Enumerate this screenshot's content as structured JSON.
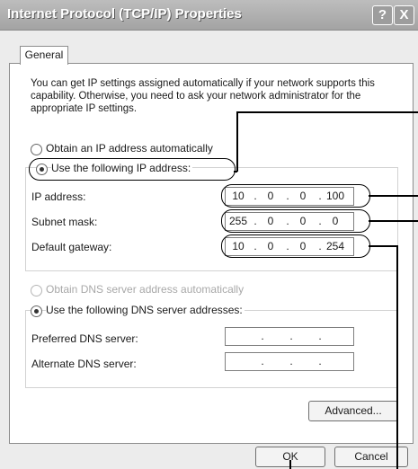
{
  "window": {
    "title": "Internet Protocol (TCP/IP) Properties",
    "help_label": "?",
    "close_label": "X"
  },
  "tabs": [
    {
      "label": "General"
    }
  ],
  "description": "You can get IP settings assigned automatically if your network supports this capability. Otherwise, you need to ask your network administrator for the appropriate IP settings.",
  "ip_mode": {
    "auto_label": "Obtain an IP address automatically",
    "manual_label": "Use the following IP address:",
    "selected": "manual"
  },
  "ip_fields": [
    {
      "label": "IP address:",
      "octets": [
        "10",
        "0",
        "0",
        "100"
      ]
    },
    {
      "label": "Subnet mask:",
      "octets": [
        "255",
        "0",
        "0",
        "0"
      ]
    },
    {
      "label": "Default gateway:",
      "octets": [
        "10",
        "0",
        "0",
        "254"
      ]
    }
  ],
  "dns_mode": {
    "auto_label": "Obtain DNS server address automatically",
    "manual_label": "Use the following DNS server addresses:",
    "selected": "manual"
  },
  "dns_fields": [
    {
      "label": "Preferred DNS server:",
      "octets": [
        "",
        "",
        "",
        ""
      ]
    },
    {
      "label": "Alternate DNS server:",
      "octets": [
        "",
        "",
        "",
        ""
      ]
    }
  ],
  "buttons": {
    "advanced": "Advanced...",
    "ok": "OK",
    "cancel": "Cancel"
  },
  "colors": {
    "title_bar": "#a9a9a9",
    "dialog_bg": "#ececec",
    "callout": "#000000"
  }
}
